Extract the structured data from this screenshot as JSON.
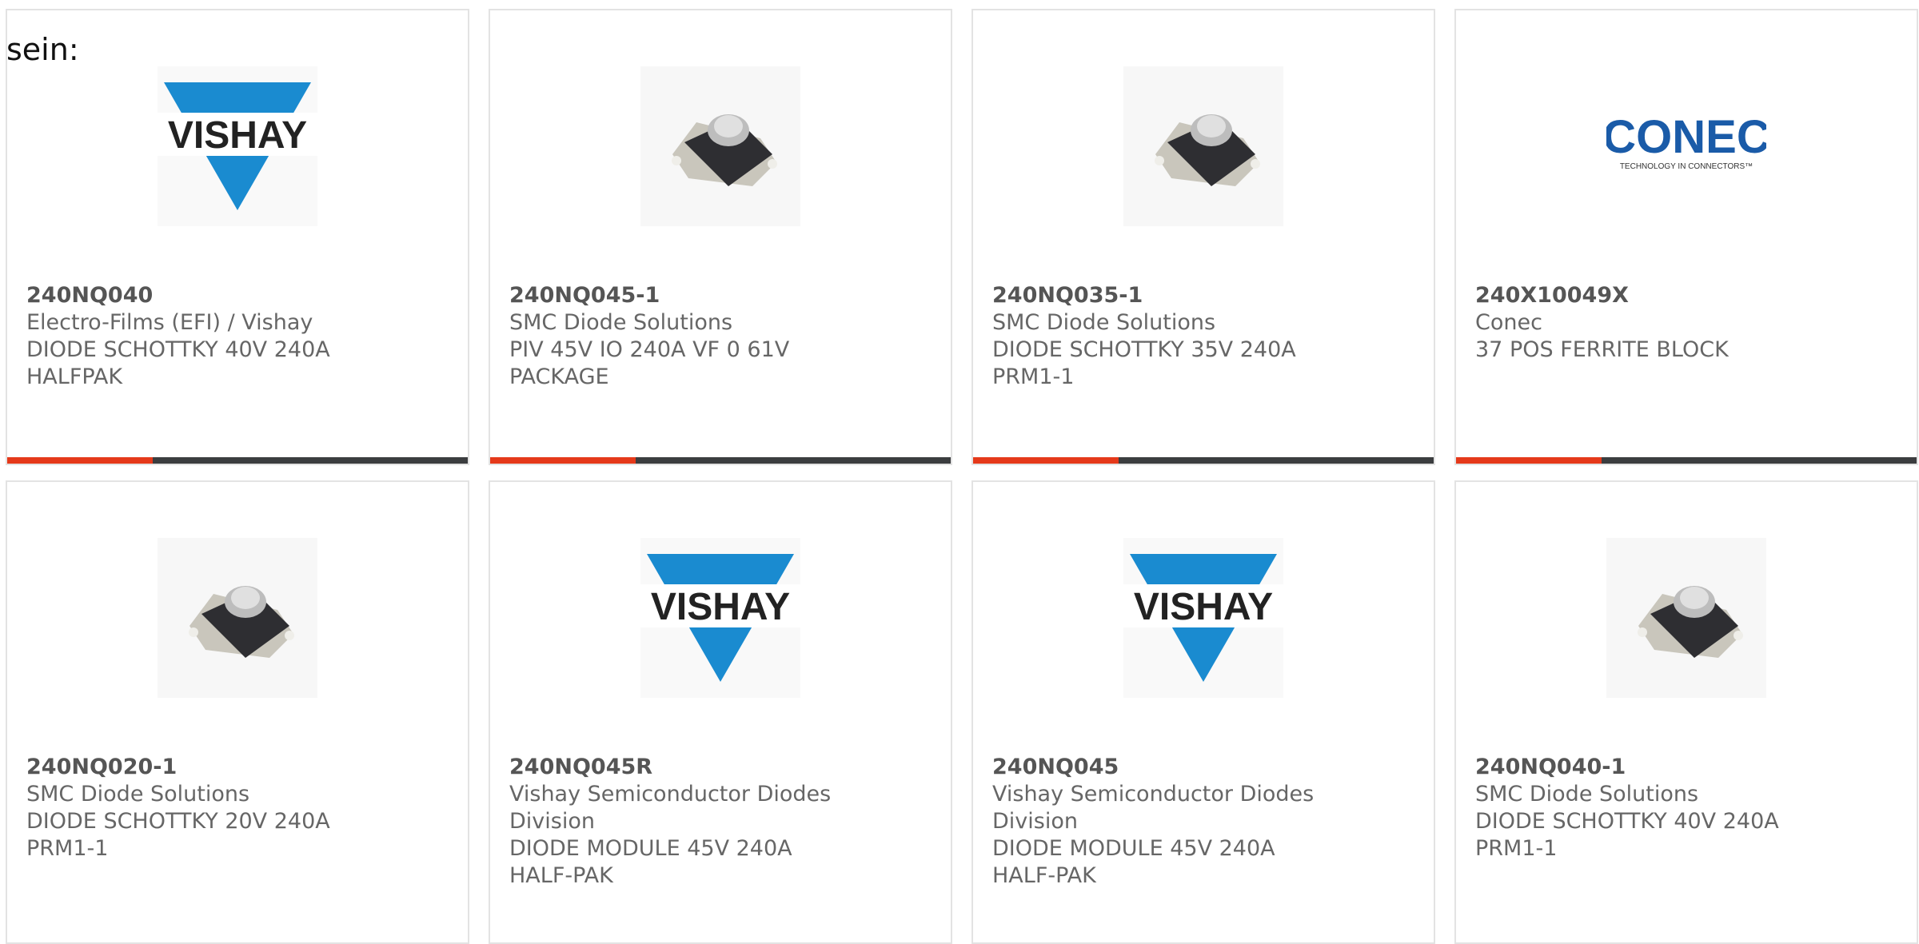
{
  "lead_text": "sein:",
  "products": [
    {
      "part": "240NQ040",
      "manufacturer": "Electro-Films (EFI) / Vishay",
      "description": "DIODE SCHOTTKY 40V 240A HALFPAK",
      "image": "vishay-logo"
    },
    {
      "part": "240NQ045-1",
      "manufacturer": "SMC Diode Solutions",
      "description": "PIV 45V IO 240A VF 0 61V PACKAGE",
      "image": "diode-module-photo"
    },
    {
      "part": "240NQ035-1",
      "manufacturer": "SMC Diode Solutions",
      "description": "DIODE SCHOTTKY 35V 240A PRM1-1",
      "image": "diode-module-photo"
    },
    {
      "part": "240X10049X",
      "manufacturer": "Conec",
      "description": "37 POS FERRITE BLOCK",
      "image": "conec-logo",
      "logo_text": "CONEC",
      "logo_tagline": "TECHNOLOGY IN CONNECTORS™"
    },
    {
      "part": "240NQ020-1",
      "manufacturer": "SMC Diode Solutions",
      "description": "DIODE SCHOTTKY 20V 240A PRM1-1",
      "image": "diode-module-photo"
    },
    {
      "part": "240NQ045R",
      "manufacturer": "Vishay Semiconductor Diodes Division",
      "description": "DIODE MODULE 45V 240A HALF-PAK",
      "image": "vishay-logo"
    },
    {
      "part": "240NQ045",
      "manufacturer": "Vishay Semiconductor Diodes Division",
      "description": "DIODE MODULE 45V 240A HALF-PAK",
      "image": "vishay-logo"
    },
    {
      "part": "240NQ040-1",
      "manufacturer": "SMC Diode Solutions",
      "description": "DIODE SCHOTTKY 40V 240A PRM1-1",
      "image": "diode-module-photo"
    }
  ],
  "logos": {
    "vishay_text": "VISHAY"
  },
  "colors": {
    "accent": "#e5391a",
    "bar": "#3b3d3f",
    "vishay_blue": "#1a8bd0",
    "conec_blue": "#1a5ba8"
  }
}
